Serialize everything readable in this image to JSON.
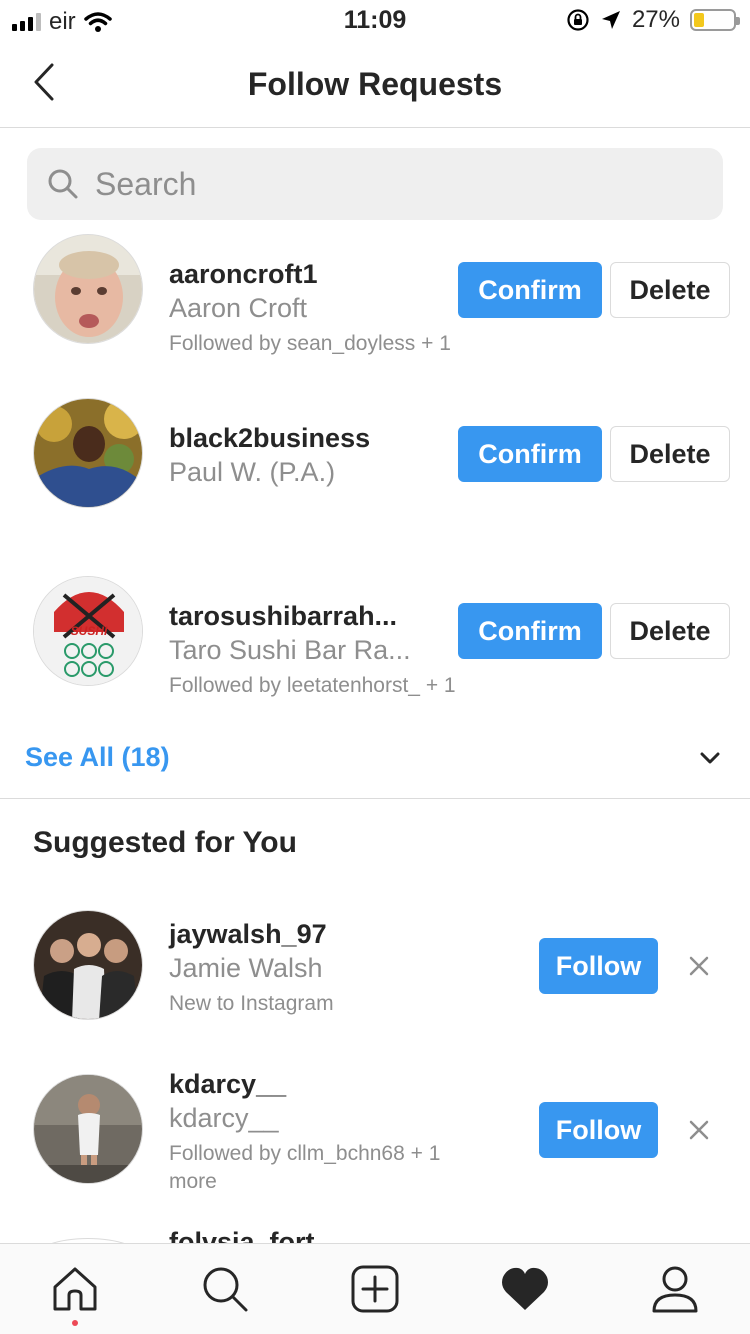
{
  "status_bar": {
    "carrier": "eir",
    "time": "11:09",
    "battery_percent": "27%",
    "battery_level": 0.27
  },
  "header": {
    "title": "Follow Requests"
  },
  "search": {
    "placeholder": "Search"
  },
  "requests": [
    {
      "username": "aaroncroft1",
      "full_name": "Aaron Croft",
      "subtitle": "Followed by sean_doyless + 1",
      "confirm_label": "Confirm",
      "delete_label": "Delete"
    },
    {
      "username": "black2business",
      "full_name": "Paul W. (P.A.)",
      "subtitle": "",
      "confirm_label": "Confirm",
      "delete_label": "Delete"
    },
    {
      "username": "tarosushibarrah...",
      "full_name": "Taro Sushi Bar Ra...",
      "subtitle": "Followed by leetatenhorst_ + 1",
      "confirm_label": "Confirm",
      "delete_label": "Delete"
    }
  ],
  "see_all": {
    "label": "See All (18)"
  },
  "suggested": {
    "title": "Suggested for You",
    "items": [
      {
        "username": "jaywalsh_97",
        "full_name": "Jamie Walsh",
        "subtitle": "New to Instagram",
        "follow_label": "Follow"
      },
      {
        "username": "kdarcy__",
        "full_name": "kdarcy__",
        "subtitle": "Followed by cllm_bchn68 + 1 more",
        "follow_label": "Follow"
      },
      {
        "username": "folvsia_fort",
        "full_name": "",
        "subtitle": "",
        "follow_label": ""
      }
    ]
  },
  "tabbar": {
    "icons": [
      "home-icon",
      "search-icon",
      "add-post-icon",
      "activity-heart-icon",
      "profile-icon"
    ]
  },
  "colors": {
    "accent": "#3897f0",
    "notification_dot": "#ed4956",
    "battery": "#f3c81d"
  }
}
